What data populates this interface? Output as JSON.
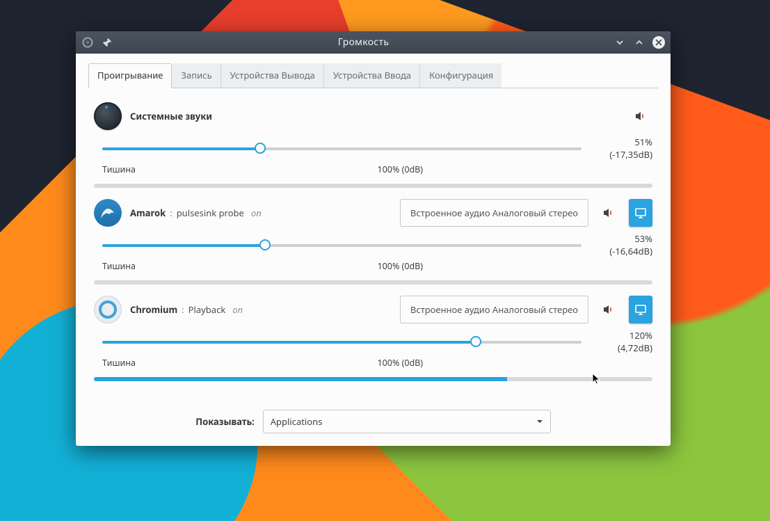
{
  "window": {
    "title": "Громкость"
  },
  "tabs": [
    {
      "label": "Проигрывание",
      "active": true
    },
    {
      "label": "Запись"
    },
    {
      "label": "Устройства Вывода"
    },
    {
      "label": "Устройства Ввода"
    },
    {
      "label": "Конфигурация"
    }
  ],
  "scale": {
    "silence": "Тишина",
    "nominal": "100% (0dB)"
  },
  "streams": [
    {
      "id": "system-sounds",
      "icon": "knob",
      "name": "Системные звуки",
      "desc": "",
      "state": "",
      "device": null,
      "has_toggle": false,
      "percent": 33,
      "value_label": "51% (-17,35dB)"
    },
    {
      "id": "amarok",
      "icon": "amarok",
      "name": "Amarok",
      "desc": "pulsesink probe",
      "state": "on",
      "device": "Встроенное аудио Аналоговый стерео",
      "has_toggle": true,
      "percent": 34,
      "value_label": "53% (-16,64dB)"
    },
    {
      "id": "chromium",
      "icon": "chromium",
      "name": "Chromium",
      "desc": "Playback",
      "state": "on",
      "device": "Встроенное аудио Аналоговый стерео",
      "has_toggle": true,
      "percent": 78,
      "value_label": "120% (4,72dB)",
      "progress_percent": 74
    }
  ],
  "footer": {
    "label": "Показывать:",
    "combo_value": "Applications"
  }
}
